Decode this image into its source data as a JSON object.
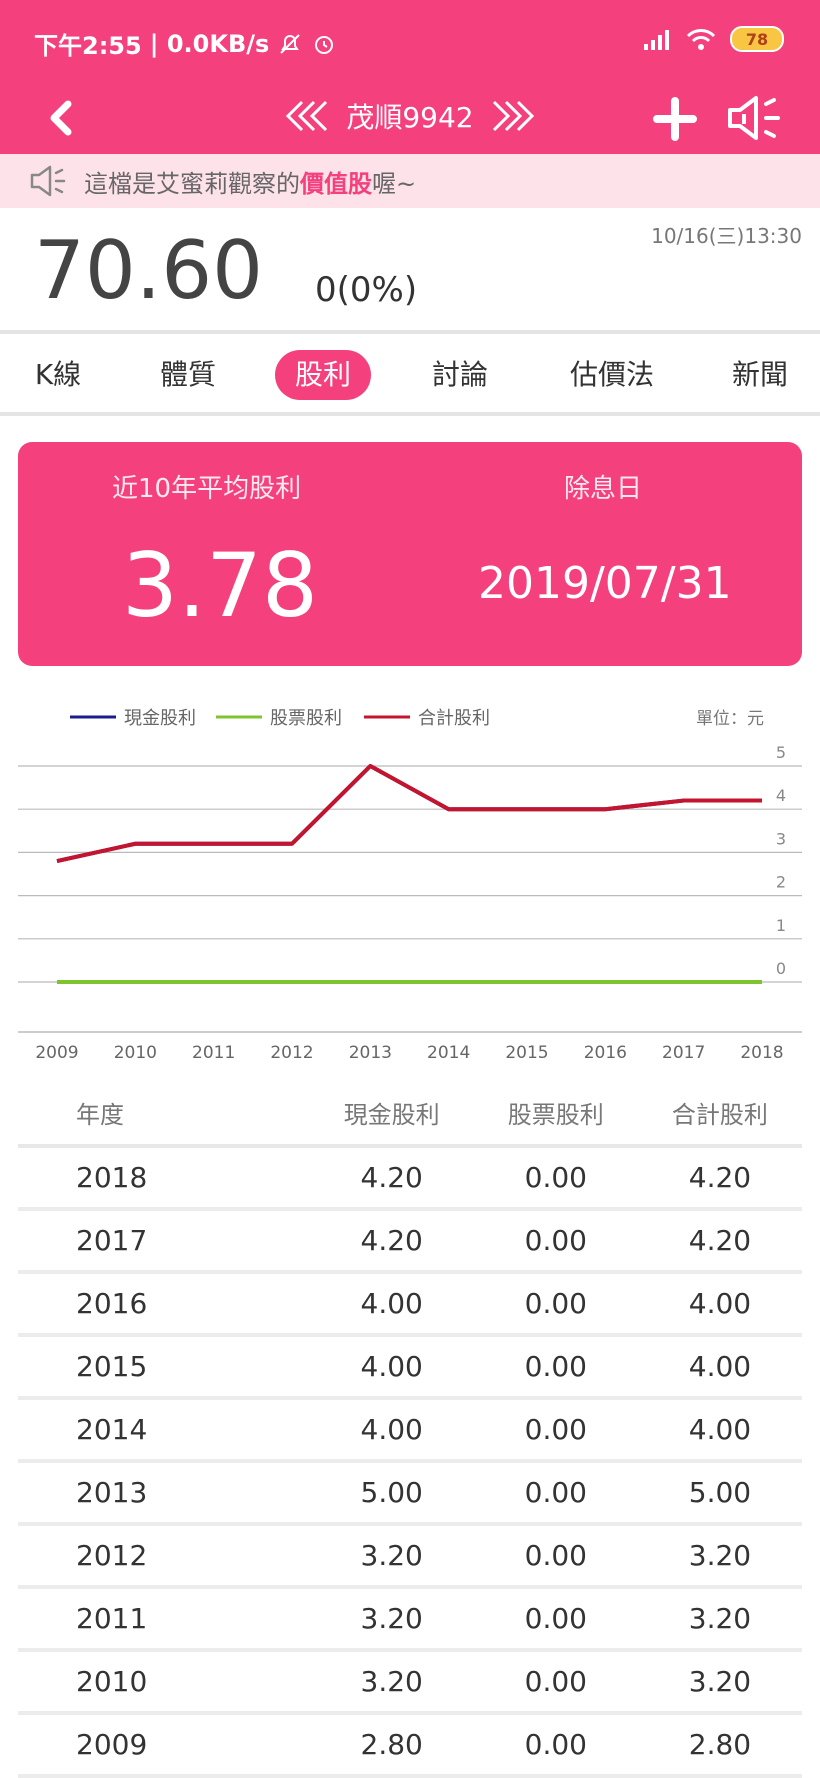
{
  "status_bar": {
    "time": "下午2:55",
    "net": "| 0.0KB/s",
    "battery": "78"
  },
  "header": {
    "title": "茂順9942"
  },
  "notice": {
    "prefix": "這檔是艾蜜莉觀察的",
    "highlight": "價值股",
    "suffix": "喔~"
  },
  "quote": {
    "price": "70.60",
    "change": "0(0%)",
    "time": "10/16(三)13:30"
  },
  "tabs": [
    "K線",
    "體質",
    "股利",
    "討論",
    "估價法",
    "新聞"
  ],
  "active_tab": "股利",
  "summary": {
    "avg_label": "近10年平均股利",
    "avg_value": "3.78",
    "exdiv_label": "除息日",
    "exdiv_date": "2019/07/31"
  },
  "chart_data": {
    "type": "line",
    "unit_label": "單位：元",
    "categories": [
      "2009",
      "2010",
      "2011",
      "2012",
      "2013",
      "2014",
      "2015",
      "2016",
      "2017",
      "2018"
    ],
    "series": [
      {
        "name": "現金股利",
        "color": "#1c1c8c",
        "values": [
          2.8,
          3.2,
          3.2,
          3.2,
          5.0,
          4.0,
          4.0,
          4.0,
          4.2,
          4.2
        ]
      },
      {
        "name": "股票股利",
        "color": "#7dc42e",
        "values": [
          0,
          0,
          0,
          0,
          0,
          0,
          0,
          0,
          0,
          0
        ]
      },
      {
        "name": "合計股利",
        "color": "#c4142e",
        "values": [
          2.8,
          3.2,
          3.2,
          3.2,
          5.0,
          4.0,
          4.0,
          4.0,
          4.2,
          4.2
        ]
      }
    ],
    "yticks": [
      "0",
      "1",
      "2",
      "3",
      "4",
      "5"
    ],
    "ylim": [
      0,
      5
    ],
    "grid": true,
    "legend_position": "top-left"
  },
  "table": {
    "headers": [
      "年度",
      "現金股利",
      "股票股利",
      "合計股利"
    ],
    "rows": [
      [
        "2018",
        "4.20",
        "0.00",
        "4.20"
      ],
      [
        "2017",
        "4.20",
        "0.00",
        "4.20"
      ],
      [
        "2016",
        "4.00",
        "0.00",
        "4.00"
      ],
      [
        "2015",
        "4.00",
        "0.00",
        "4.00"
      ],
      [
        "2014",
        "4.00",
        "0.00",
        "4.00"
      ],
      [
        "2013",
        "5.00",
        "0.00",
        "5.00"
      ],
      [
        "2012",
        "3.20",
        "0.00",
        "3.20"
      ],
      [
        "2011",
        "3.20",
        "0.00",
        "3.20"
      ],
      [
        "2010",
        "3.20",
        "0.00",
        "3.20"
      ],
      [
        "2009",
        "2.80",
        "0.00",
        "2.80"
      ]
    ]
  }
}
